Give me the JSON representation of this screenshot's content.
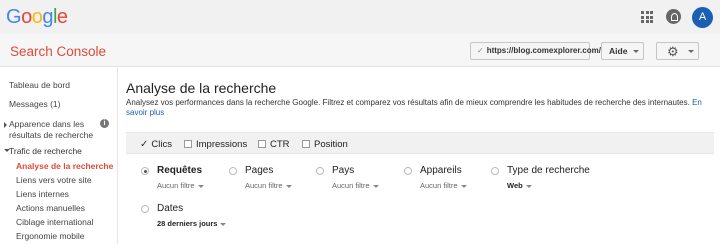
{
  "google": {
    "logo_letters": [
      {
        "ch": "G",
        "color": "#4285f4"
      },
      {
        "ch": "o",
        "color": "#ea4335"
      },
      {
        "ch": "o",
        "color": "#fbbc05"
      },
      {
        "ch": "g",
        "color": "#4285f4"
      },
      {
        "ch": "l",
        "color": "#34a853"
      },
      {
        "ch": "e",
        "color": "#ea4335"
      }
    ],
    "avatar_letter": "A"
  },
  "header": {
    "title": "Search Console",
    "site": "https://blog.comexplorer.com/",
    "help_label": "Aide"
  },
  "sidebar": {
    "items": [
      {
        "label": "Tableau de bord"
      },
      {
        "label": "Messages (1)"
      },
      {
        "label_line1": "Apparence dans les",
        "label_line2": "résultats de recherche"
      },
      {
        "label": "Trafic de recherche"
      }
    ],
    "subitems": [
      {
        "label": "Analyse de la recherche"
      },
      {
        "label": "Liens vers votre site"
      },
      {
        "label": "Liens internes"
      },
      {
        "label": "Actions manuelles"
      },
      {
        "label": "Ciblage international"
      },
      {
        "label": "Ergonomie mobile"
      }
    ]
  },
  "main": {
    "title": "Analyse de la recherche",
    "description": "Analysez vos performances dans la recherche Google. Filtrez et comparez vos résultats afin de mieux comprendre les habitudes de recherche des internautes.",
    "learn_more": "En savoir plus",
    "metrics": [
      {
        "label": "Clics",
        "checked": true
      },
      {
        "label": "Impressions",
        "checked": false
      },
      {
        "label": "CTR",
        "checked": false
      },
      {
        "label": "Position",
        "checked": false
      }
    ],
    "dimensions": [
      {
        "label": "Requêtes",
        "filter": "Aucun filtre",
        "selected": true
      },
      {
        "label": "Pages",
        "filter": "Aucun filtre",
        "selected": false
      },
      {
        "label": "Pays",
        "filter": "Aucun filtre",
        "selected": false
      },
      {
        "label": "Appareils",
        "filter": "Aucun filtre",
        "selected": false
      },
      {
        "label": "Type de recherche",
        "filter": "Web",
        "selected": false
      },
      {
        "label": "Dates",
        "filter": "28 derniers jours",
        "selected": false
      }
    ]
  },
  "colors": {
    "brand_red": "#dd4b39",
    "link_blue": "#1a5fb4"
  }
}
